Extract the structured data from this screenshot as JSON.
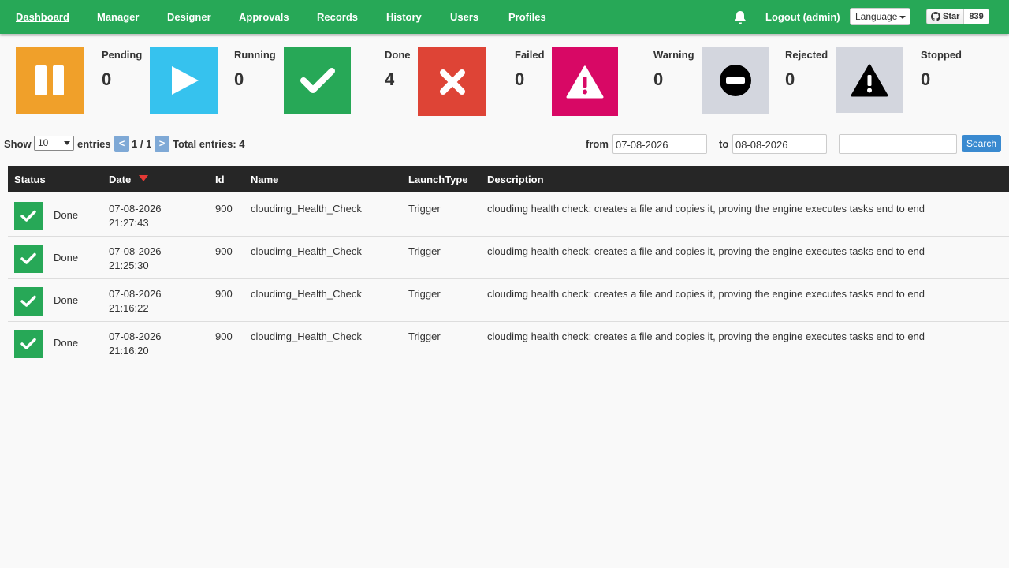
{
  "nav": {
    "items": [
      {
        "label": "Dashboard",
        "active": true
      },
      {
        "label": "Manager"
      },
      {
        "label": "Designer"
      },
      {
        "label": "Approvals"
      },
      {
        "label": "Records"
      },
      {
        "label": "History"
      },
      {
        "label": "Users"
      },
      {
        "label": "Profiles"
      }
    ],
    "logout": "Logout (admin)",
    "language": "Language",
    "github": {
      "star": "Star",
      "count": "839"
    }
  },
  "statuses": [
    {
      "label": "Pending",
      "count": "0",
      "color": "#f0a02a",
      "icon": "pause-icon"
    },
    {
      "label": "Running",
      "count": "0",
      "color": "#36c2ee",
      "icon": "play-icon"
    },
    {
      "label": "Done",
      "count": "4",
      "color": "#27a857",
      "icon": "check-icon"
    },
    {
      "label": "Failed",
      "count": "0",
      "color": "#de4436",
      "icon": "x-icon"
    },
    {
      "label": "Warning",
      "count": "0",
      "color": "#d80865",
      "icon": "warning-icon"
    },
    {
      "label": "Rejected",
      "count": "0",
      "color": "#d3d6de",
      "icon": "minus-circle-icon"
    },
    {
      "label": "Stopped",
      "count": "0",
      "color": "#d3d6de",
      "icon": "alert-icon"
    }
  ],
  "controls": {
    "show": "Show",
    "entries_value": "10",
    "entries": "entries",
    "prev": "<",
    "page": "1 / 1",
    "next": ">",
    "total": "Total entries: 4",
    "from_label": "from",
    "from_value": "07-08-2026",
    "to_label": "to",
    "to_value": "08-08-2026",
    "search_value": "",
    "search_button": "Search"
  },
  "table": {
    "headers": {
      "status": "Status",
      "date": "Date",
      "id": "Id",
      "name": "Name",
      "launch": "LaunchType",
      "description": "Description"
    },
    "rows": [
      {
        "status": "Done",
        "date": "07-08-2026",
        "time": "21:27:43",
        "id": "900",
        "name": "cloudimg_Health_Check",
        "launch": "Trigger",
        "description": "cloudimg health check: creates a file and copies it, proving the engine executes tasks end to end"
      },
      {
        "status": "Done",
        "date": "07-08-2026",
        "time": "21:25:30",
        "id": "900",
        "name": "cloudimg_Health_Check",
        "launch": "Trigger",
        "description": "cloudimg health check: creates a file and copies it, proving the engine executes tasks end to end"
      },
      {
        "status": "Done",
        "date": "07-08-2026",
        "time": "21:16:22",
        "id": "900",
        "name": "cloudimg_Health_Check",
        "launch": "Trigger",
        "description": "cloudimg health check: creates a file and copies it, proving the engine executes tasks end to end"
      },
      {
        "status": "Done",
        "date": "07-08-2026",
        "time": "21:16:20",
        "id": "900",
        "name": "cloudimg_Health_Check",
        "launch": "Trigger",
        "description": "cloudimg health check: creates a file and copies it, proving the engine executes tasks end to end"
      }
    ]
  }
}
